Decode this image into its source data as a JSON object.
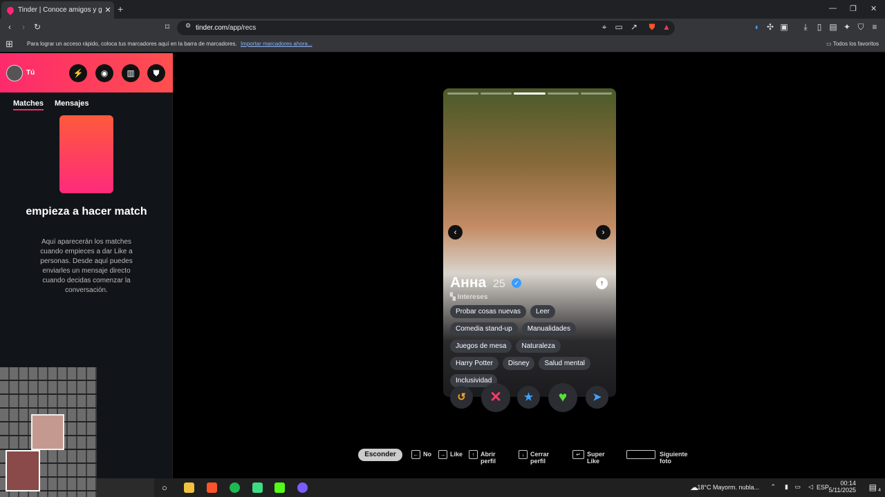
{
  "browser": {
    "tab_title": "Tinder | Conoce amigos y gente",
    "tab_close": "✕",
    "new_tab": "+",
    "url_host": "tinder.com",
    "url_path": "/app/recs",
    "bookmarks_text": "Para lograr un acceso rápido, coloca tus marcadores aquí en la barra de marcadores.",
    "bookmarks_link": "Importar marcadores ahora...",
    "favorites": "Todos los favoritos"
  },
  "sidebar": {
    "user_label": "Tú",
    "tabs": [
      "Matches",
      "Mensajes"
    ],
    "empty_title": "empieza a hacer match",
    "empty_desc": "Aquí aparecerán los matches cuando empieces a dar Like a personas. Desde aquí puedes enviarles un mensaje directo cuando decidas comenzar la conversación."
  },
  "profile": {
    "name": "Анна",
    "age": "25",
    "interests_label": "Intereses",
    "interests": [
      "Probar cosas nuevas",
      "Leer",
      "Comedia stand-up",
      "Manualidades",
      "Juegos de mesa",
      "Naturaleza",
      "Harry Potter",
      "Disney",
      "Salud mental",
      "Inclusividad"
    ],
    "photo_count": 5,
    "current_photo": 3
  },
  "hints": {
    "hide": "Esconder",
    "no": "No",
    "like": "Like",
    "open": "Abrir perfil",
    "close": "Cerrar perfil",
    "super": "Super Like",
    "next": "Siguiente foto"
  },
  "taskbar": {
    "weather": "18°C  Mayorm. nubla...",
    "lang": "ESP",
    "time": "00:14",
    "date": "5/11/2025",
    "notif": "4"
  },
  "colors": {
    "brand": "#fd2a6c",
    "undo": "#f5a623",
    "nope": "#fe3b6b",
    "superlike": "#3fa2ff",
    "like": "#5bdc3a"
  }
}
